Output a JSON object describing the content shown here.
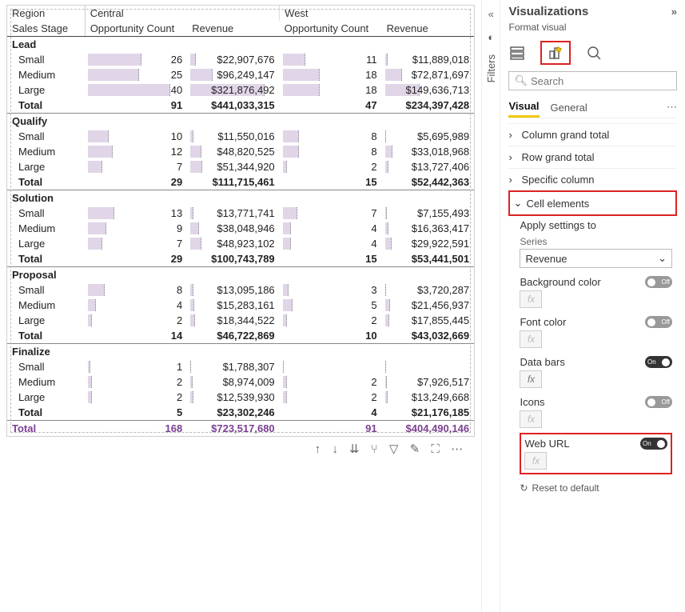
{
  "pane": {
    "title": "Visualizations",
    "subtitle": "Format visual",
    "search_placeholder": "Search",
    "tabs": {
      "visual": "Visual",
      "general": "General"
    },
    "sections": {
      "col_total": "Column grand total",
      "row_total": "Row grand total",
      "specific": "Specific column",
      "cell_elements": "Cell elements",
      "apply_to": "Apply settings to",
      "series_label": "Series",
      "series_value": "Revenue",
      "bg": "Background color",
      "font": "Font color",
      "bars": "Data bars",
      "icons": "Icons",
      "weburl": "Web URL",
      "reset": "Reset to default",
      "on": "On",
      "off": "Off",
      "fx": "fx"
    }
  },
  "filters_label": "Filters",
  "headers": {
    "region": "Region",
    "sales_stage": "Sales Stage",
    "central": "Central",
    "west": "West",
    "opp": "Opportunity Count",
    "rev": "Revenue",
    "total": "Total"
  },
  "chart_data": {
    "type": "table",
    "groups": [
      {
        "name": "Lead",
        "rows": [
          {
            "label": "Small",
            "c_opp": 26,
            "c_rev": 22907676,
            "w_opp": 11,
            "w_rev": 11889018
          },
          {
            "label": "Medium",
            "c_opp": 25,
            "c_rev": 96249147,
            "w_opp": 18,
            "w_rev": 72871697
          },
          {
            "label": "Large",
            "c_opp": 40,
            "c_rev": 321876492,
            "w_opp": 18,
            "w_rev": 149636713
          }
        ],
        "total": {
          "c_opp": 91,
          "c_rev": 441033315,
          "w_opp": 47,
          "w_rev": 234397428
        }
      },
      {
        "name": "Qualify",
        "rows": [
          {
            "label": "Small",
            "c_opp": 10,
            "c_rev": 11550016,
            "w_opp": 8,
            "w_rev": 5695989
          },
          {
            "label": "Medium",
            "c_opp": 12,
            "c_rev": 48820525,
            "w_opp": 8,
            "w_rev": 33018968
          },
          {
            "label": "Large",
            "c_opp": 7,
            "c_rev": 51344920,
            "w_opp": 2,
            "w_rev": 13727406
          }
        ],
        "total": {
          "c_opp": 29,
          "c_rev": 111715461,
          "w_opp": 15,
          "w_rev": 52442363
        }
      },
      {
        "name": "Solution",
        "rows": [
          {
            "label": "Small",
            "c_opp": 13,
            "c_rev": 13771741,
            "w_opp": 7,
            "w_rev": 7155493
          },
          {
            "label": "Medium",
            "c_opp": 9,
            "c_rev": 38048946,
            "w_opp": 4,
            "w_rev": 16363417
          },
          {
            "label": "Large",
            "c_opp": 7,
            "c_rev": 48923102,
            "w_opp": 4,
            "w_rev": 29922591
          }
        ],
        "total": {
          "c_opp": 29,
          "c_rev": 100743789,
          "w_opp": 15,
          "w_rev": 53441501
        }
      },
      {
        "name": "Proposal",
        "rows": [
          {
            "label": "Small",
            "c_opp": 8,
            "c_rev": 13095186,
            "w_opp": 3,
            "w_rev": 3720287
          },
          {
            "label": "Medium",
            "c_opp": 4,
            "c_rev": 15283161,
            "w_opp": 5,
            "w_rev": 21456937
          },
          {
            "label": "Large",
            "c_opp": 2,
            "c_rev": 18344522,
            "w_opp": 2,
            "w_rev": 17855445
          }
        ],
        "total": {
          "c_opp": 14,
          "c_rev": 46722869,
          "w_opp": 10,
          "w_rev": 43032669
        }
      },
      {
        "name": "Finalize",
        "rows": [
          {
            "label": "Small",
            "c_opp": 1,
            "c_rev": 1788307,
            "w_opp": null,
            "w_rev": null
          },
          {
            "label": "Medium",
            "c_opp": 2,
            "c_rev": 8974009,
            "w_opp": 2,
            "w_rev": 7926517
          },
          {
            "label": "Large",
            "c_opp": 2,
            "c_rev": 12539930,
            "w_opp": 2,
            "w_rev": 13249668
          }
        ],
        "total": {
          "c_opp": 5,
          "c_rev": 23302246,
          "w_opp": 4,
          "w_rev": 21176185
        }
      }
    ],
    "grand_total": {
      "c_opp": 168,
      "c_rev": 723517680,
      "w_opp": 91,
      "w_rev": 404490146
    },
    "max": {
      "opp": 40,
      "rev": 321876492
    }
  }
}
